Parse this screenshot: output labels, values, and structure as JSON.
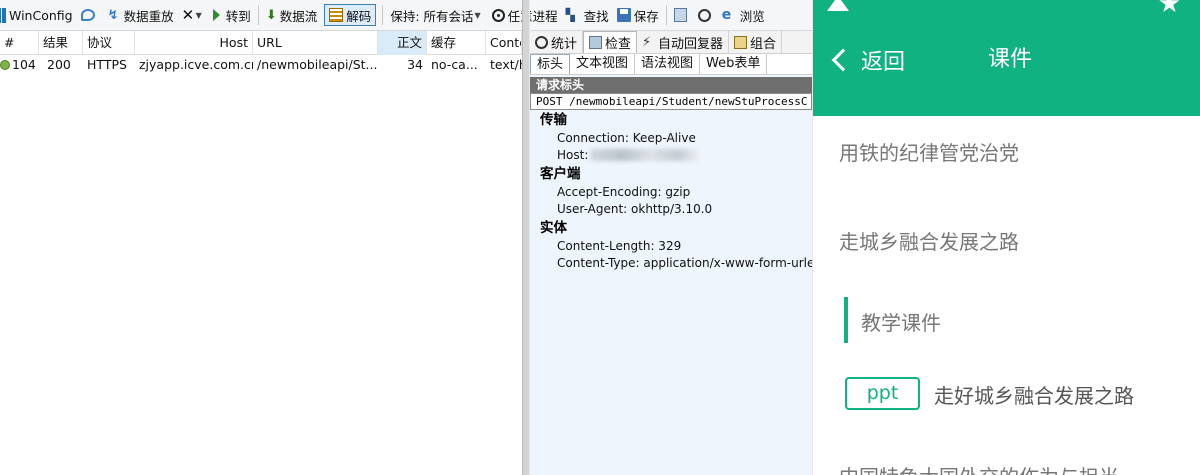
{
  "toolbar": {
    "winconfig": "WinConfig",
    "replay": "数据重放",
    "goto": "转到",
    "stream": "数据流",
    "decode": "解码",
    "keep": "保持: 所有会话",
    "any_process": "任意进程",
    "find": "查找",
    "save": "保存",
    "browse": "浏览"
  },
  "sessions": {
    "columns": [
      "#",
      "结果",
      "协议",
      "Host",
      "URL",
      "正文",
      "缓存",
      "Conte"
    ],
    "rows": [
      {
        "id": "104",
        "result": "200",
        "protocol": "HTTPS",
        "host": "zjyapp.icve.com.cn",
        "url": "/newmobileapi/St...",
        "body": "34",
        "cache": "no-ca...",
        "content_type": "text/h"
      }
    ]
  },
  "inspector": {
    "tabs": [
      "统计",
      "检查",
      "自动回复器",
      "组合"
    ],
    "subtabs": [
      "标头",
      "文本视图",
      "语法视图",
      "Web表单"
    ],
    "request_title": "请求标头",
    "request_line": "POST /newmobileapi/Student/newStuProcessC",
    "groups": [
      {
        "name": "传输",
        "items": [
          "Connection: Keep-Alive",
          "Host:"
        ]
      },
      {
        "name": "客户端",
        "items": [
          "Accept-Encoding: gzip",
          "User-Agent: okhttp/3.10.0"
        ]
      },
      {
        "name": "实体",
        "items": [
          "Content-Length: 329",
          "Content-Type: application/x-www-form-urlenc"
        ]
      }
    ]
  },
  "phone": {
    "back": "返回",
    "title": "课件",
    "items": [
      "用铁的纪律管党治党",
      "走城乡融合发展之路",
      "教学课件"
    ],
    "ppt_badge": "ppt",
    "ppt_title": "走好城乡融合发展之路",
    "partial_item": "中国特色大国外交的作为与担当"
  },
  "colors": {
    "accent": "#0fb280",
    "selected_column": "#d9eaf8",
    "inspector_bg": "#eef5fc"
  }
}
